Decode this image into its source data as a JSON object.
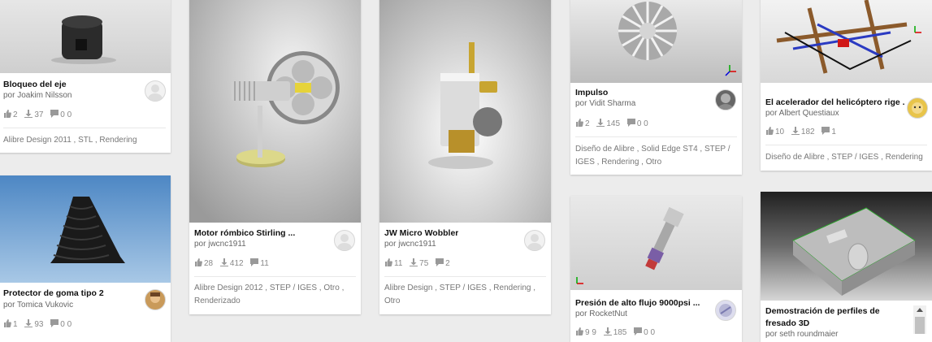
{
  "cards": [
    {
      "title": "Bloqueo del eje",
      "author": "por Joakim Nilsson",
      "likes": "2",
      "downloads": "37",
      "comments": "0 0",
      "tags": "Alibre Design 2011 , STL , Rendering"
    },
    {
      "title": "Protector de goma tipo 2",
      "author": "por Tomica Vukovic",
      "likes": "1",
      "downloads": "93",
      "comments": "0 0"
    },
    {
      "title": "Motor rómbico Stirling ...",
      "author": "por jwcnc1911",
      "likes": "28",
      "downloads": "412",
      "comments": "11",
      "tags": "Alibre Design 2012 , STEP / IGES , Otro , Renderizado"
    },
    {
      "title": "JW Micro Wobbler",
      "author": "por jwcnc1911",
      "likes": "11",
      "downloads": "75",
      "comments": "2",
      "tags": "Alibre Design , STEP / IGES , Rendering , Otro"
    },
    {
      "title": "Impulso",
      "author": "por Vidit Sharma",
      "likes": "2",
      "downloads": "145",
      "comments": "0 0",
      "tags": "Diseño de Alibre , Solid Edge ST4 , STEP / IGES , Rendering , Otro"
    },
    {
      "title": "Presión de alto flujo 9000psi ...",
      "author": "por RocketNut",
      "likes": "9 9",
      "downloads": "185",
      "comments": "0 0"
    },
    {
      "title": "El acelerador del helicóptero rige ...",
      "author": "por Albert Questiaux",
      "likes": "10",
      "downloads": "182",
      "comments": "1",
      "tags": "Diseño de Alibre , STEP / IGES , Rendering"
    },
    {
      "title": "Demostración de perfiles de fresado 3D",
      "author": "por seth roundmaier"
    }
  ]
}
